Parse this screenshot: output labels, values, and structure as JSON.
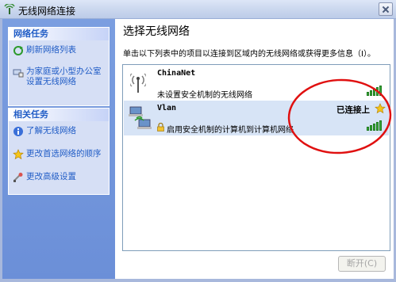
{
  "window": {
    "title": "无线网络连接"
  },
  "sidebar": {
    "network_tasks": {
      "header": "网络任务",
      "items": [
        {
          "label": "刷新网络列表",
          "icon": "refresh-icon"
        },
        {
          "label": "为家庭或小型办公室设置无线网络",
          "icon": "home-network-icon"
        }
      ]
    },
    "related_tasks": {
      "header": "相关任务",
      "items": [
        {
          "label": "了解无线网络",
          "icon": "info-icon"
        },
        {
          "label": "更改首选网络的顺序",
          "icon": "star-icon"
        },
        {
          "label": "更改高级设置",
          "icon": "settings-icon"
        }
      ]
    }
  },
  "main": {
    "title": "选择无线网络",
    "hint": "单击以下列表中的项目以连接到区域内的无线网络或获得更多信息（I）。",
    "networks": [
      {
        "name": "ChinaNet",
        "description": "未设置安全机制的无线网络",
        "status": "",
        "signal_bars": 5,
        "selected": false
      },
      {
        "name": "Vlan",
        "description": "启用安全机制的计算机到计算机网络",
        "status": "已连接上",
        "signal_bars": 5,
        "selected": true
      }
    ],
    "connect_button": "断开(C)"
  },
  "colors": {
    "accent": "#215dc6",
    "selection": "#d7e4f6",
    "signal": "#39a939",
    "annotation": "#e01010"
  }
}
